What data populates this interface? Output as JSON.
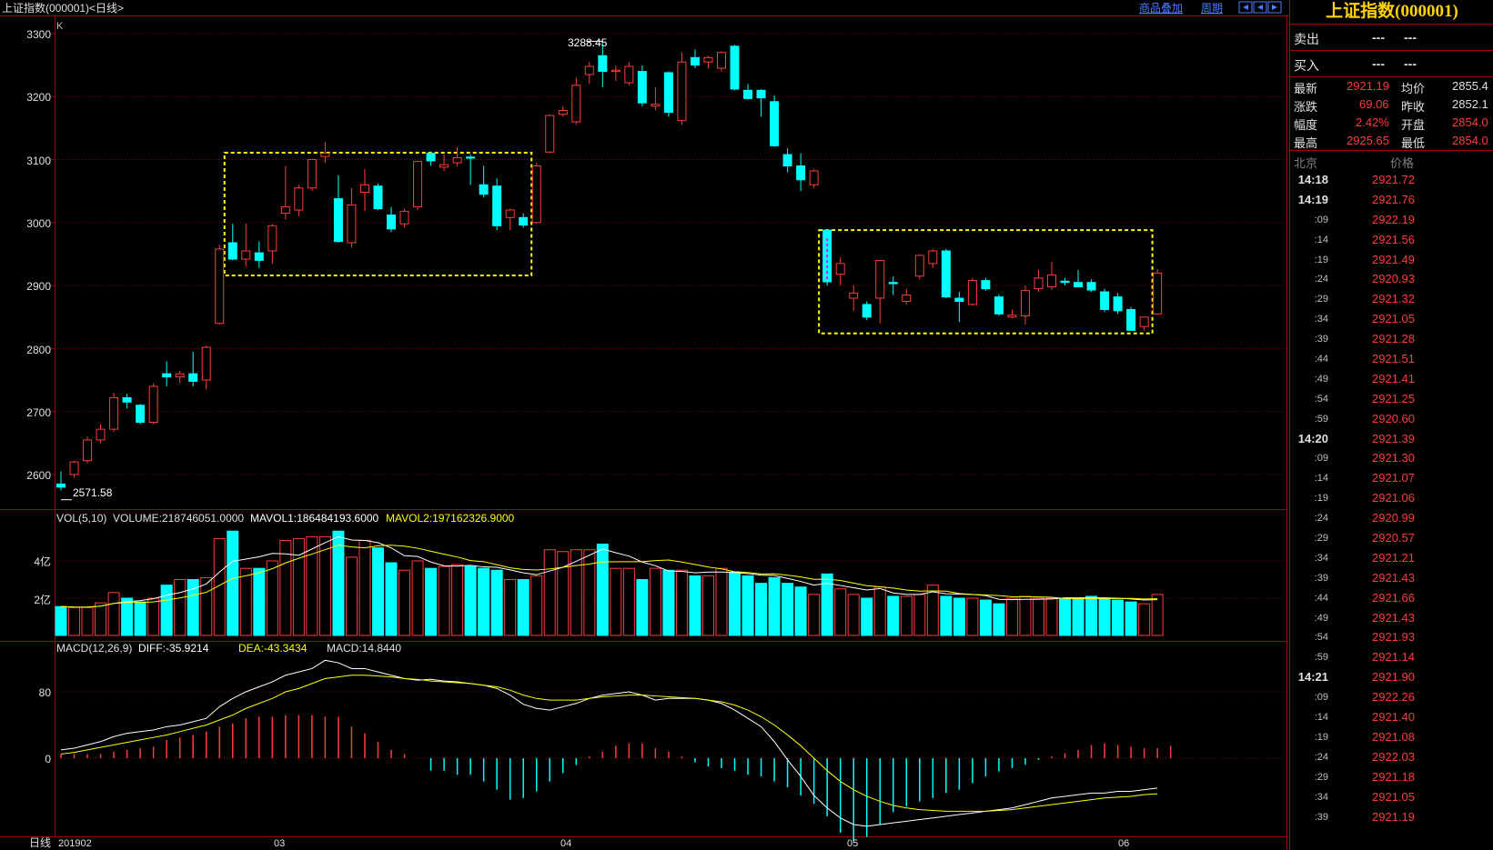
{
  "header": {
    "title": "上证指数(000001)<日线>",
    "links": [
      "商品叠加",
      "周期"
    ]
  },
  "kline": {
    "label": "K",
    "y_ticks": [
      "3300",
      "3200",
      "3100",
      "3000",
      "2900",
      "2800",
      "2700",
      "2600"
    ],
    "high_label": "3288.45",
    "low_label": "2571.58"
  },
  "volume": {
    "legend_name": "VOL(5,10)",
    "legend_volume": "VOLUME:218746051.0000",
    "legend_mavol1": "MAVOL1:186484193.6000",
    "legend_mavol2": "MAVOL2:197162326.9000",
    "y_ticks": [
      "4亿",
      "2亿"
    ]
  },
  "macd": {
    "legend_name": "MACD(12,26,9)",
    "legend_diff": "DIFF:-35.9214",
    "legend_dea": "DEA:-43.3434",
    "legend_macd": "MACD:14.8440",
    "y_ticks": [
      "80",
      "0"
    ]
  },
  "x_axis": {
    "period_label": "日线",
    "labels": [
      "201902",
      "03",
      "04",
      "05",
      "06"
    ]
  },
  "colors": {
    "up": "#ff3b3b",
    "down": "#00ffff",
    "ma1": "#ffffff",
    "ma2": "#ffff00",
    "box": "#ffff00",
    "grid": "#a00000"
  },
  "quote_panel": {
    "title": "上证指数(000001)",
    "sell_label": "卖出",
    "buy_label": "买入",
    "sell_vals": [
      "---",
      "---"
    ],
    "buy_vals": [
      "---",
      "---"
    ],
    "rows": [
      {
        "l1": "最新",
        "v1": "2921.19",
        "l2": "均价",
        "v2": "2855.4"
      },
      {
        "l1": "涨跌",
        "v1": "69.06",
        "l2": "昨收",
        "v2": "2852.1"
      },
      {
        "l1": "幅度",
        "v1": "2.42%",
        "l2": "开盘",
        "v2": "2854.0"
      },
      {
        "l1": "最高",
        "v1": "2925.65",
        "l2": "最低",
        "v2": "2854.0"
      }
    ],
    "ticks_header": [
      "北京",
      "价格"
    ],
    "ticks": [
      {
        "t": "14:18",
        "p": "2921.72",
        "major": true
      },
      {
        "t": "14:19",
        "p": "2921.76",
        "major": true
      },
      {
        "t": ":09",
        "p": "2922.19"
      },
      {
        "t": ":14",
        "p": "2921.56"
      },
      {
        "t": ":19",
        "p": "2921.49"
      },
      {
        "t": ":24",
        "p": "2920.93"
      },
      {
        "t": ":29",
        "p": "2921.32"
      },
      {
        "t": ":34",
        "p": "2921.05"
      },
      {
        "t": ":39",
        "p": "2921.28"
      },
      {
        "t": ":44",
        "p": "2921.51"
      },
      {
        "t": ":49",
        "p": "2921.41"
      },
      {
        "t": ":54",
        "p": "2921.25"
      },
      {
        "t": ":59",
        "p": "2920.60"
      },
      {
        "t": "14:20",
        "p": "2921.39",
        "major": true
      },
      {
        "t": ":09",
        "p": "2921.30"
      },
      {
        "t": ":14",
        "p": "2921.07"
      },
      {
        "t": ":19",
        "p": "2921.06"
      },
      {
        "t": ":24",
        "p": "2920.99"
      },
      {
        "t": ":29",
        "p": "2920.57"
      },
      {
        "t": ":34",
        "p": "2921.21"
      },
      {
        "t": ":39",
        "p": "2921.43"
      },
      {
        "t": ":44",
        "p": "2921.66"
      },
      {
        "t": ":49",
        "p": "2921.43"
      },
      {
        "t": ":54",
        "p": "2921.93"
      },
      {
        "t": ":59",
        "p": "2921.14"
      },
      {
        "t": "14:21",
        "p": "2921.90",
        "major": true
      },
      {
        "t": ":09",
        "p": "2922.26"
      },
      {
        "t": ":14",
        "p": "2921.40"
      },
      {
        "t": ":19",
        "p": "2921.08"
      },
      {
        "t": ":24",
        "p": "2922.03"
      },
      {
        "t": ":29",
        "p": "2921.18"
      },
      {
        "t": ":34",
        "p": "2921.05"
      },
      {
        "t": ":39",
        "p": "2921.19"
      }
    ]
  },
  "chart_data": {
    "type": "candlestick",
    "y_range": [
      2560,
      3320
    ],
    "candles": [
      {
        "o": 2585,
        "h": 2605,
        "l": 2575,
        "c": 2580
      },
      {
        "o": 2600,
        "h": 2622,
        "l": 2595,
        "c": 2620
      },
      {
        "o": 2622,
        "h": 2660,
        "l": 2618,
        "c": 2655
      },
      {
        "o": 2655,
        "h": 2680,
        "l": 2650,
        "c": 2672
      },
      {
        "o": 2672,
        "h": 2730,
        "l": 2668,
        "c": 2722
      },
      {
        "o": 2722,
        "h": 2728,
        "l": 2705,
        "c": 2715
      },
      {
        "o": 2710,
        "h": 2712,
        "l": 2680,
        "c": 2683
      },
      {
        "o": 2683,
        "h": 2745,
        "l": 2680,
        "c": 2740
      },
      {
        "o": 2760,
        "h": 2780,
        "l": 2740,
        "c": 2755
      },
      {
        "o": 2755,
        "h": 2765,
        "l": 2745,
        "c": 2760
      },
      {
        "o": 2760,
        "h": 2795,
        "l": 2740,
        "c": 2748
      },
      {
        "o": 2750,
        "h": 2805,
        "l": 2735,
        "c": 2802
      },
      {
        "o": 2840,
        "h": 2965,
        "l": 2838,
        "c": 2958
      },
      {
        "o": 2968,
        "h": 2998,
        "l": 2940,
        "c": 2942
      },
      {
        "o": 2942,
        "h": 2998,
        "l": 2930,
        "c": 2955
      },
      {
        "o": 2952,
        "h": 2970,
        "l": 2928,
        "c": 2940
      },
      {
        "o": 2955,
        "h": 2998,
        "l": 2935,
        "c": 2995
      },
      {
        "o": 3015,
        "h": 3090,
        "l": 3005,
        "c": 3025
      },
      {
        "o": 3020,
        "h": 3060,
        "l": 3010,
        "c": 3055
      },
      {
        "o": 3055,
        "h": 3100,
        "l": 3050,
        "c": 3100
      },
      {
        "o": 3105,
        "h": 3128,
        "l": 3095,
        "c": 3110
      },
      {
        "o": 3038,
        "h": 3075,
        "l": 2968,
        "c": 2970
      },
      {
        "o": 2968,
        "h": 3055,
        "l": 2960,
        "c": 3028
      },
      {
        "o": 3048,
        "h": 3085,
        "l": 3018,
        "c": 3060
      },
      {
        "o": 3058,
        "h": 3062,
        "l": 3020,
        "c": 3022
      },
      {
        "o": 3012,
        "h": 3025,
        "l": 2985,
        "c": 2990
      },
      {
        "o": 2998,
        "h": 3022,
        "l": 2992,
        "c": 3018
      },
      {
        "o": 3025,
        "h": 3098,
        "l": 3020,
        "c": 3097
      },
      {
        "o": 3110,
        "h": 3113,
        "l": 3090,
        "c": 3098
      },
      {
        "o": 3088,
        "h": 3108,
        "l": 3082,
        "c": 3092
      },
      {
        "o": 3095,
        "h": 3120,
        "l": 3090,
        "c": 3103
      },
      {
        "o": 3104,
        "h": 3108,
        "l": 3060,
        "c": 3103
      },
      {
        "o": 3060,
        "h": 3090,
        "l": 3040,
        "c": 3045
      },
      {
        "o": 3058,
        "h": 3070,
        "l": 2988,
        "c": 2995
      },
      {
        "o": 3008,
        "h": 3022,
        "l": 2988,
        "c": 3020
      },
      {
        "o": 3008,
        "h": 3015,
        "l": 2992,
        "c": 2996
      },
      {
        "o": 3000,
        "h": 3095,
        "l": 2998,
        "c": 3090
      },
      {
        "o": 3112,
        "h": 3172,
        "l": 3110,
        "c": 3170
      },
      {
        "o": 3172,
        "h": 3185,
        "l": 3168,
        "c": 3178
      },
      {
        "o": 3160,
        "h": 3230,
        "l": 3155,
        "c": 3218
      },
      {
        "o": 3235,
        "h": 3255,
        "l": 3220,
        "c": 3248
      },
      {
        "o": 3265,
        "h": 3288,
        "l": 3215,
        "c": 3240
      },
      {
        "o": 3240,
        "h": 3250,
        "l": 3225,
        "c": 3242
      },
      {
        "o": 3222,
        "h": 3255,
        "l": 3218,
        "c": 3248
      },
      {
        "o": 3240,
        "h": 3250,
        "l": 3185,
        "c": 3190
      },
      {
        "o": 3185,
        "h": 3215,
        "l": 3178,
        "c": 3188
      },
      {
        "o": 3238,
        "h": 3240,
        "l": 3168,
        "c": 3175
      },
      {
        "o": 3162,
        "h": 3270,
        "l": 3155,
        "c": 3255
      },
      {
        "o": 3262,
        "h": 3275,
        "l": 3245,
        "c": 3250
      },
      {
        "o": 3255,
        "h": 3265,
        "l": 3245,
        "c": 3262
      },
      {
        "o": 3245,
        "h": 3272,
        "l": 3240,
        "c": 3270
      },
      {
        "o": 3280,
        "h": 3282,
        "l": 3210,
        "c": 3212
      },
      {
        "o": 3210,
        "h": 3220,
        "l": 3195,
        "c": 3197
      },
      {
        "o": 3210,
        "h": 3212,
        "l": 3168,
        "c": 3198
      },
      {
        "o": 3192,
        "h": 3202,
        "l": 3120,
        "c": 3122
      },
      {
        "o": 3108,
        "h": 3118,
        "l": 3080,
        "c": 3090
      },
      {
        "o": 3090,
        "h": 3110,
        "l": 3050,
        "c": 3068
      },
      {
        "o": 3060,
        "h": 3085,
        "l": 3055,
        "c": 3082
      },
      {
        "o": 2988,
        "h": 2990,
        "l": 2900,
        "c": 2906
      },
      {
        "o": 2918,
        "h": 2945,
        "l": 2900,
        "c": 2935
      },
      {
        "o": 2880,
        "h": 2900,
        "l": 2860,
        "c": 2888
      },
      {
        "o": 2870,
        "h": 2875,
        "l": 2845,
        "c": 2850
      },
      {
        "o": 2880,
        "h": 2940,
        "l": 2840,
        "c": 2940
      },
      {
        "o": 2905,
        "h": 2915,
        "l": 2885,
        "c": 2903
      },
      {
        "o": 2875,
        "h": 2895,
        "l": 2870,
        "c": 2885
      },
      {
        "o": 2915,
        "h": 2950,
        "l": 2910,
        "c": 2948
      },
      {
        "o": 2935,
        "h": 2958,
        "l": 2928,
        "c": 2955
      },
      {
        "o": 2955,
        "h": 2958,
        "l": 2880,
        "c": 2882
      },
      {
        "o": 2880,
        "h": 2890,
        "l": 2842,
        "c": 2875
      },
      {
        "o": 2870,
        "h": 2912,
        "l": 2868,
        "c": 2908
      },
      {
        "o": 2908,
        "h": 2912,
        "l": 2892,
        "c": 2895
      },
      {
        "o": 2882,
        "h": 2886,
        "l": 2852,
        "c": 2855
      },
      {
        "o": 2850,
        "h": 2862,
        "l": 2848,
        "c": 2853
      },
      {
        "o": 2852,
        "h": 2900,
        "l": 2838,
        "c": 2892
      },
      {
        "o": 2895,
        "h": 2925,
        "l": 2890,
        "c": 2912
      },
      {
        "o": 2898,
        "h": 2938,
        "l": 2893,
        "c": 2917
      },
      {
        "o": 2907,
        "h": 2912,
        "l": 2900,
        "c": 2905
      },
      {
        "o": 2905,
        "h": 2925,
        "l": 2898,
        "c": 2898
      },
      {
        "o": 2905,
        "h": 2910,
        "l": 2890,
        "c": 2893
      },
      {
        "o": 2890,
        "h": 2895,
        "l": 2858,
        "c": 2862
      },
      {
        "o": 2882,
        "h": 2888,
        "l": 2855,
        "c": 2860
      },
      {
        "o": 2862,
        "h": 2866,
        "l": 2828,
        "c": 2829
      },
      {
        "o": 2835,
        "h": 2850,
        "l": 2828,
        "c": 2850
      },
      {
        "o": 2855,
        "h": 2926,
        "l": 2855,
        "c": 2920
      }
    ],
    "volumes": [
      1.55,
      1.5,
      1.5,
      1.75,
      2.3,
      2.0,
      1.8,
      2.0,
      2.7,
      3.0,
      3.0,
      3.1,
      5.2,
      5.6,
      3.6,
      3.6,
      4.0,
      5.1,
      5.2,
      5.3,
      5.3,
      5.6,
      4.2,
      5.1,
      4.7,
      3.9,
      3.5,
      4.0,
      3.6,
      3.7,
      3.8,
      3.7,
      3.6,
      3.5,
      3.0,
      3.0,
      3.2,
      4.6,
      4.5,
      4.6,
      4.6,
      4.9,
      3.6,
      3.6,
      3.0,
      3.6,
      3.5,
      3.5,
      3.2,
      3.2,
      3.6,
      3.4,
      3.2,
      2.8,
      3.1,
      2.8,
      2.6,
      2.2,
      3.3,
      2.5,
      2.2,
      2.0,
      2.6,
      2.1,
      2.1,
      2.2,
      2.7,
      2.1,
      2.0,
      2.0,
      1.9,
      1.7,
      2.0,
      2.1,
      2.0,
      2.0,
      2.0,
      2.0,
      2.1,
      2.0,
      1.9,
      1.8,
      1.7,
      2.2
    ],
    "macd_bars": [
      5,
      5,
      5,
      5,
      8,
      10,
      12,
      14,
      22,
      25,
      28,
      32,
      38,
      42,
      48,
      50,
      50,
      52,
      52,
      52,
      50,
      50,
      38,
      30,
      20,
      10,
      5,
      0,
      -15,
      -15,
      -20,
      -20,
      -28,
      -38,
      -50,
      -48,
      -40,
      -28,
      -18,
      -8,
      2,
      8,
      15,
      18,
      18,
      12,
      8,
      2,
      -5,
      -10,
      -12,
      -15,
      -20,
      -22,
      -28,
      -35,
      -45,
      -55,
      -70,
      -90,
      -100,
      -95,
      -80,
      -65,
      -58,
      -52,
      -48,
      -42,
      -38,
      -30,
      -22,
      -16,
      -12,
      -8,
      -2,
      2,
      6,
      10,
      16,
      18,
      16,
      14,
      12,
      12,
      15
    ],
    "diff": [
      10,
      12,
      16,
      20,
      26,
      30,
      32,
      34,
      38,
      40,
      44,
      48,
      62,
      72,
      80,
      86,
      92,
      100,
      104,
      108,
      118,
      115,
      108,
      108,
      104,
      100,
      96,
      94,
      95,
      93,
      92,
      90,
      88,
      84,
      76,
      65,
      60,
      58,
      62,
      66,
      72,
      76,
      78,
      80,
      76,
      70,
      72,
      72,
      72,
      70,
      66,
      58,
      48,
      38,
      20,
      -2,
      -22,
      -45,
      -60,
      -72,
      -80,
      -82,
      -80,
      -78,
      -76,
      -74,
      -72,
      -70,
      -68,
      -66,
      -64,
      -62,
      -60,
      -56,
      -52,
      -48,
      -46,
      -44,
      -42,
      -42,
      -40,
      -40,
      -38,
      -36
    ],
    "dea": [
      5,
      7,
      10,
      13,
      16,
      19,
      22,
      25,
      28,
      32,
      36,
      40,
      46,
      52,
      60,
      66,
      72,
      80,
      84,
      90,
      96,
      98,
      100,
      100,
      99,
      98,
      96,
      95,
      93,
      92,
      91,
      90,
      88,
      86,
      82,
      76,
      72,
      70,
      70,
      70,
      72,
      74,
      75,
      76,
      76,
      75,
      74,
      73,
      72,
      70,
      68,
      64,
      58,
      50,
      40,
      28,
      15,
      0,
      -15,
      -28,
      -38,
      -46,
      -52,
      -57,
      -60,
      -62,
      -63,
      -64,
      -64,
      -64,
      -64,
      -63,
      -62,
      -60,
      -58,
      -56,
      -54,
      -52,
      -50,
      -48,
      -47,
      -46,
      -44,
      -43
    ]
  }
}
